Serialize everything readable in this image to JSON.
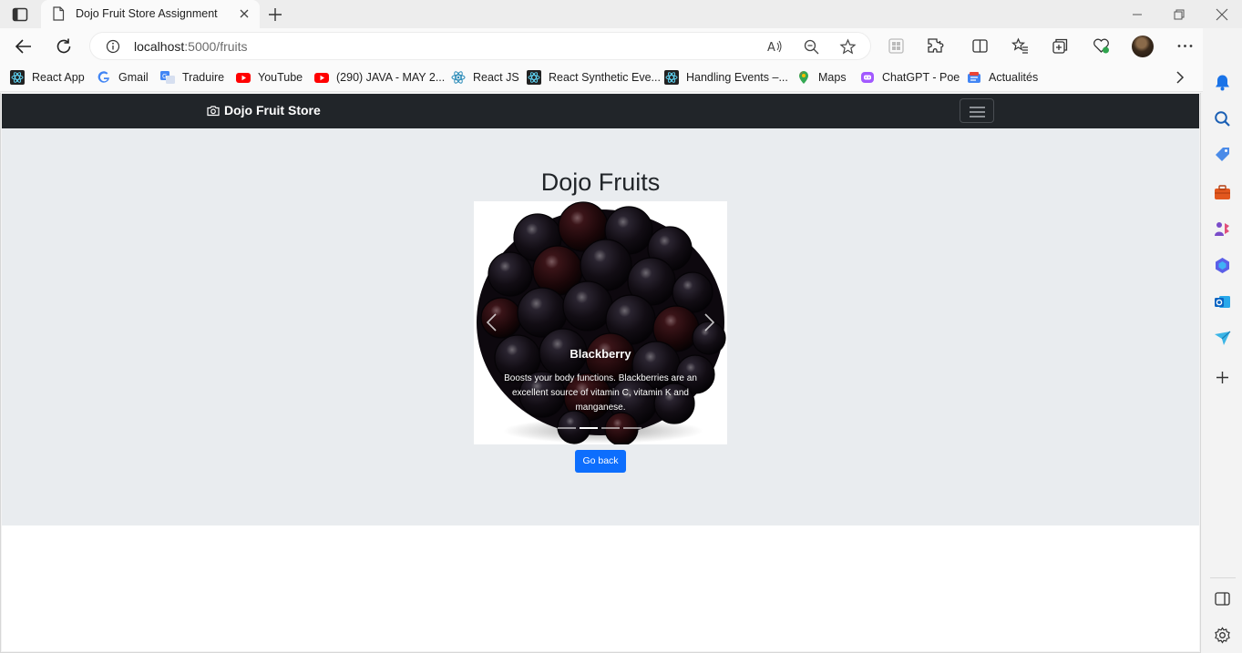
{
  "browser": {
    "tab_title": "Dojo Fruit Store Assignment",
    "url_host": "localhost",
    "url_path": ":5000/fruits",
    "bookmarks": [
      {
        "label": "React App",
        "icon": "react-icon"
      },
      {
        "label": "Gmail",
        "icon": "google-icon"
      },
      {
        "label": "Traduire",
        "icon": "translate-icon"
      },
      {
        "label": "YouTube",
        "icon": "youtube-icon"
      },
      {
        "label": "(290) JAVA - MAY 2...",
        "icon": "youtube-icon"
      },
      {
        "label": "React JS",
        "icon": "react-icon"
      },
      {
        "label": "React Synthetic Eve...",
        "icon": "react-icon"
      },
      {
        "label": "Handling Events –...",
        "icon": "react-icon"
      },
      {
        "label": "Maps",
        "icon": "maps-icon"
      },
      {
        "label": "ChatGPT - Poe",
        "icon": "poe-icon"
      },
      {
        "label": "Actualités",
        "icon": "news-icon"
      }
    ]
  },
  "page": {
    "brand": "Dojo Fruit Store",
    "heading": "Dojo Fruits",
    "carousel": {
      "title": "Blackberry",
      "text": "Boosts your body functions. Blackberries are an excellent source of vitamin C, vitamin K and manganese.",
      "slide_count": 4,
      "active_index": 1
    },
    "back_button": "Go back"
  },
  "colors": {
    "navbar": "#212529",
    "hero": "#e9ecef",
    "primary_button": "#0d6efd"
  }
}
